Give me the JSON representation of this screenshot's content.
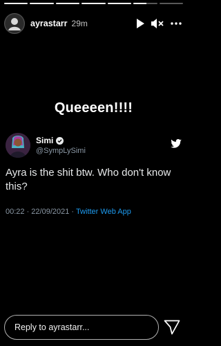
{
  "story": {
    "progress": [
      1,
      1,
      1,
      1,
      1,
      0.55,
      0
    ],
    "username": "ayrastarr",
    "time": "29m",
    "caption": "Queeeen!!!!",
    "controls": [
      "play-icon",
      "mute-icon",
      "more-icon"
    ]
  },
  "tweet": {
    "name": "Simi",
    "handle": "@SympLySimi",
    "verified": true,
    "text": "Ayra is the shit btw. Who don't know this?",
    "date": "00:22 · 22/09/2021 · ",
    "app": "Twitter Web App"
  },
  "reply": {
    "placeholder": "Reply to ayrastarr..."
  },
  "colors": {
    "background": "#000000",
    "twitter_blue": "#1d9bf0",
    "secondary_text": "#8b98a5"
  }
}
